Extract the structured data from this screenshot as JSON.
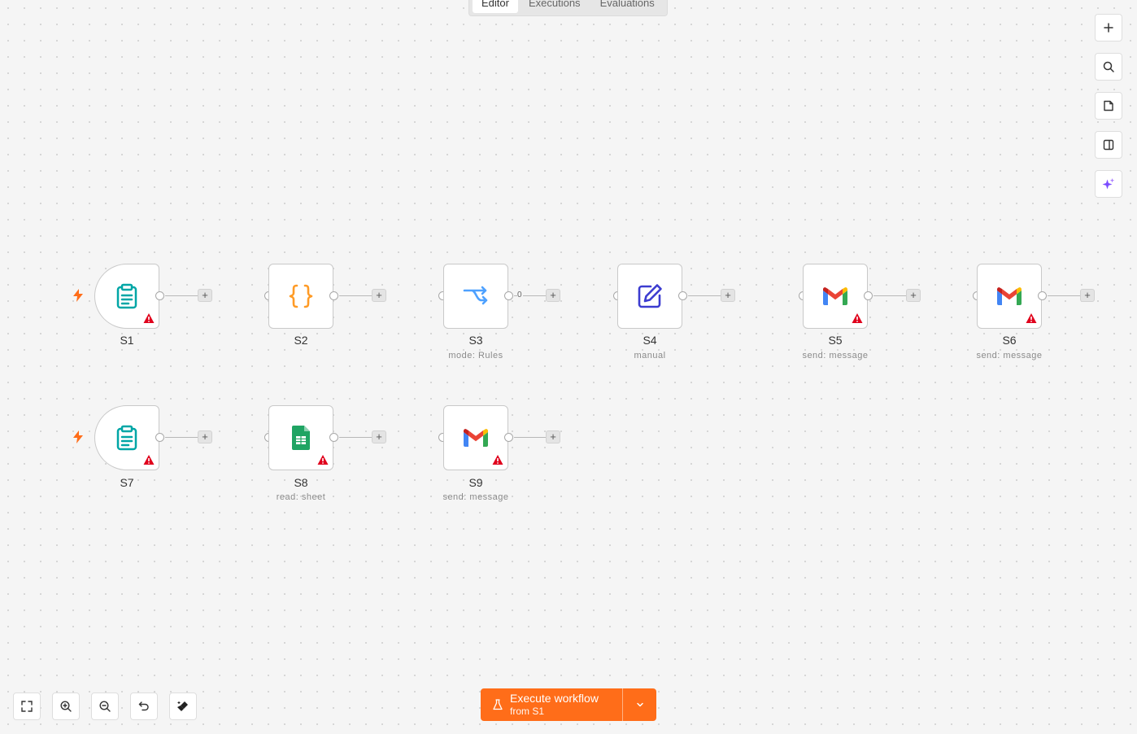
{
  "tabs": [
    {
      "label": "Editor",
      "active": true
    },
    {
      "label": "Executions",
      "active": false
    },
    {
      "label": "Evaluations",
      "active": false
    }
  ],
  "nodes": [
    {
      "id": "S1",
      "name": "S1",
      "subtitle": "",
      "icon": "clipboard-icon",
      "trigger": true,
      "warning": true
    },
    {
      "id": "S2",
      "name": "S2",
      "subtitle": "",
      "icon": "code-braces-icon",
      "trigger": false,
      "warning": false
    },
    {
      "id": "S3",
      "name": "S3",
      "subtitle": "mode: Rules",
      "icon": "switch-icon",
      "trigger": false,
      "warning": false,
      "output_label": "0"
    },
    {
      "id": "S4",
      "name": "S4",
      "subtitle": "manual",
      "icon": "edit-icon",
      "trigger": false,
      "warning": false
    },
    {
      "id": "S5",
      "name": "S5",
      "subtitle": "send: message",
      "icon": "gmail-icon",
      "trigger": false,
      "warning": true
    },
    {
      "id": "S6",
      "name": "S6",
      "subtitle": "send: message",
      "icon": "gmail-icon",
      "trigger": false,
      "warning": true
    },
    {
      "id": "S7",
      "name": "S7",
      "subtitle": "",
      "icon": "clipboard-icon",
      "trigger": true,
      "warning": true
    },
    {
      "id": "S8",
      "name": "S8",
      "subtitle": "read: sheet",
      "icon": "google-sheets-icon",
      "trigger": false,
      "warning": true
    },
    {
      "id": "S9",
      "name": "S9",
      "subtitle": "send: message",
      "icon": "gmail-icon",
      "trigger": false,
      "warning": true
    }
  ],
  "right_toolbar": [
    "plus-icon",
    "search-icon",
    "sticky-note-icon",
    "panel-icon",
    "ai-sparkle-icon"
  ],
  "bottom_controls": [
    "fit-view-icon",
    "zoom-in-icon",
    "zoom-out-icon",
    "undo-icon",
    "tidy-up-icon"
  ],
  "execute": {
    "title": "Execute workflow",
    "subtitle": "from S1"
  },
  "colors": {
    "accent": "#ff6d19",
    "warning": "#e0001c",
    "clipboard": "#00a6a6",
    "braces": "#ff9b26",
    "switch": "#4ea1ff",
    "edit": "#3c3cd0",
    "sheets": "#1fa463"
  }
}
